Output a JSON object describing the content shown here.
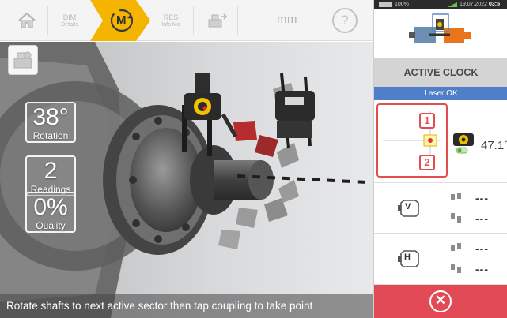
{
  "toolbar": {
    "home_icon": "home-icon",
    "dim_label": "DIM",
    "dim_sub": "Details",
    "measure_label": "M",
    "res_label": "RES",
    "res_sub": "Info Mo",
    "correct_icon": "machine-move-icon",
    "unit": "mm",
    "help": "?"
  },
  "viewport": {
    "rotation": {
      "value": "38°",
      "label": "Rotation"
    },
    "readings": {
      "value": "2",
      "label": "Readings"
    },
    "quality": {
      "value": "0%",
      "label": "Quality"
    },
    "instruction": "Rotate shafts to next active sector then tap coupling to take point"
  },
  "status_bar": {
    "battery": "100%",
    "date": "19.07.2022",
    "time": "03:5"
  },
  "panel": {
    "title": "ACTIVE CLOCK",
    "laser_status": "Laser OK",
    "sensor": {
      "badge_1": "1",
      "badge_2": "2",
      "angle": "47.1°"
    },
    "vertical": {
      "label": "V",
      "row1": "---",
      "row2": "---"
    },
    "horizontal": {
      "label": "H",
      "row1": "---",
      "row2": "---"
    },
    "stop_symbol": "✕"
  },
  "colors": {
    "measure_tab": "#f5b400",
    "laser_banner": "#4f7fc8",
    "stop_button": "#e24a55",
    "highlight": "#e34d4d"
  }
}
